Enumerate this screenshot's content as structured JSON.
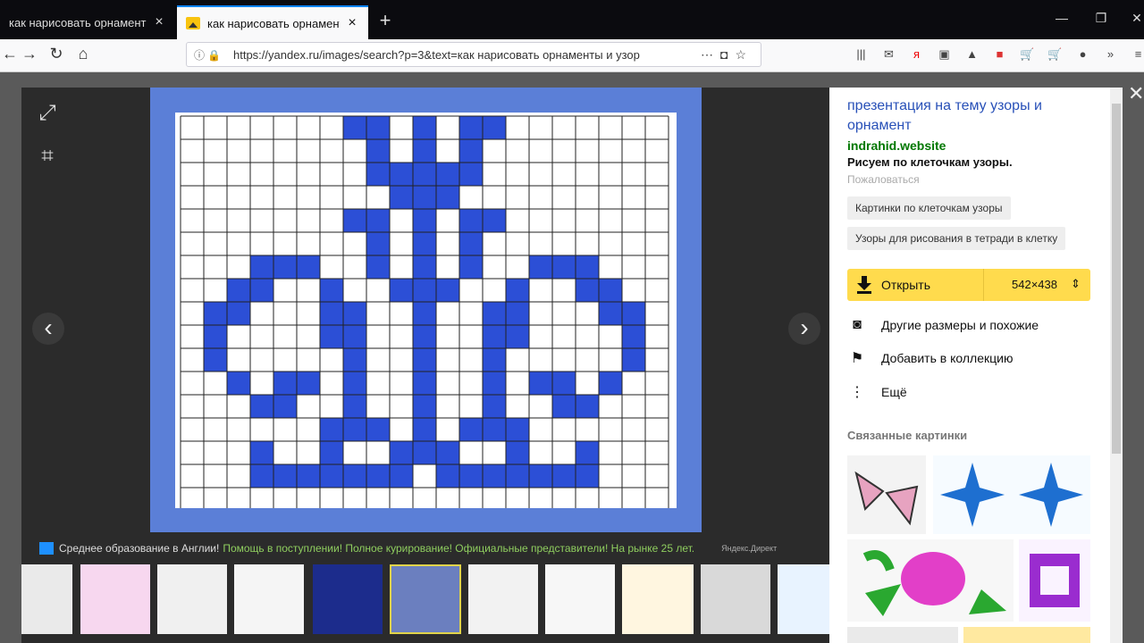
{
  "browser": {
    "tabs": [
      {
        "title": "как нарисовать орнаменты и",
        "active": false
      },
      {
        "title": "как нарисовать орнаменты и",
        "active": true
      }
    ],
    "url": "https://yandex.ru/images/search?p=3&text=как нарисовать орнаменты и узор"
  },
  "viewer": {
    "ad_text": "Среднее образование в Англии!",
    "ad_green": "Помощь в поступлении! Полное курирование! Официальные представители! На рынке 25 лет.",
    "ad_source": "Яндекс.Директ"
  },
  "panel": {
    "title": "презентация на тему узоры и орнамент",
    "site": "indrahid.website",
    "description": "Рисуем по клеточкам узоры.",
    "report": "Пожаловаться",
    "chips": [
      "Картинки по клеточкам узоры",
      "Узоры для рисования в тетради в клетку"
    ],
    "open_label": "Открыть",
    "size": "542×438",
    "actions": [
      "Другие размеры и похожие",
      "Добавить в коллекцию",
      "Ещё"
    ],
    "related_heading": "Связанные картинки"
  },
  "colors": {
    "accent_yellow": "#ffdb4d",
    "pattern_blue": "#2c4fd6",
    "frame_blue": "#5b7fd7",
    "link_blue": "#2951b8",
    "site_green": "#007700"
  }
}
